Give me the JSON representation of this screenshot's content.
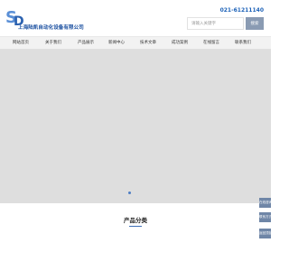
{
  "header": {
    "company_name": "上海陆凯自动化设备有限公司",
    "phone": "021-61211140",
    "search_placeholder": "请输入关键字",
    "search_button": "搜索"
  },
  "nav": {
    "items": [
      {
        "label": "网站首页"
      },
      {
        "label": "关于我们"
      },
      {
        "label": "产品展示"
      },
      {
        "label": "新闻中心"
      },
      {
        "label": "技术文章"
      },
      {
        "label": "成功案例"
      },
      {
        "label": "在线留言"
      },
      {
        "label": "联系我们"
      }
    ]
  },
  "section": {
    "title": "产品分类"
  },
  "float_tabs": [
    "在线咨询",
    "联系方式",
    "返回顶部"
  ],
  "colors": {
    "accent": "#1d62b8",
    "button": "#8a9bb3",
    "nav_bg": "#f2f2f2"
  }
}
